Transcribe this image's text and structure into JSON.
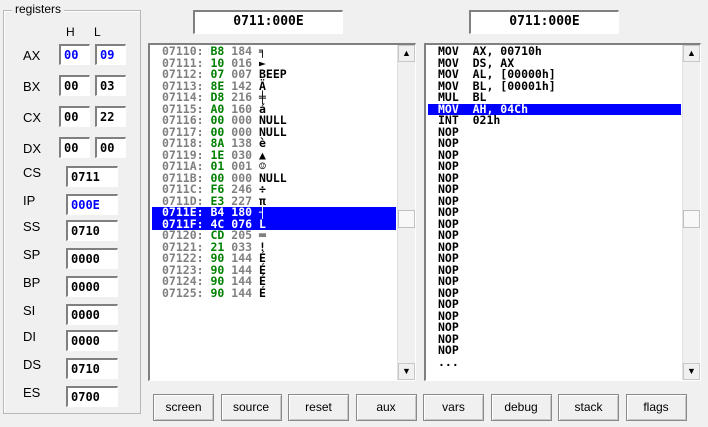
{
  "registers": {
    "title": "registers",
    "col_h": "H",
    "col_l": "L",
    "split": [
      {
        "name": "AX",
        "h": "00",
        "l": "09",
        "h_blue": true,
        "l_blue": true
      },
      {
        "name": "BX",
        "h": "00",
        "l": "03",
        "h_blue": false,
        "l_blue": false
      },
      {
        "name": "CX",
        "h": "00",
        "l": "22",
        "h_blue": false,
        "l_blue": false
      },
      {
        "name": "DX",
        "h": "00",
        "l": "00",
        "h_blue": false,
        "l_blue": false
      }
    ],
    "full": [
      {
        "name": "CS",
        "value": "0711",
        "blue": false
      },
      {
        "name": "IP",
        "value": "000E",
        "blue": true
      },
      {
        "name": "SS",
        "value": "0710",
        "blue": false
      },
      {
        "name": "SP",
        "value": "0000",
        "blue": false
      },
      {
        "name": "BP",
        "value": "0000",
        "blue": false
      },
      {
        "name": "SI",
        "value": "0000",
        "blue": false
      },
      {
        "name": "DI",
        "value": "0000",
        "blue": false
      },
      {
        "name": "DS",
        "value": "0710",
        "blue": false
      },
      {
        "name": "ES",
        "value": "0700",
        "blue": false
      }
    ]
  },
  "memory": {
    "address": "0711:000E",
    "rows": [
      {
        "addr": "07110:",
        "hex": "B8",
        "dec": "184",
        "ch": "╕",
        "sel": false
      },
      {
        "addr": "07111:",
        "hex": "10",
        "dec": "016",
        "ch": "►",
        "sel": false
      },
      {
        "addr": "07112:",
        "hex": "07",
        "dec": "007",
        "ch": "BEEP",
        "sel": false
      },
      {
        "addr": "07113:",
        "hex": "8E",
        "dec": "142",
        "ch": "Ä",
        "sel": false
      },
      {
        "addr": "07114:",
        "hex": "D8",
        "dec": "216",
        "ch": "╪",
        "sel": false
      },
      {
        "addr": "07115:",
        "hex": "A0",
        "dec": "160",
        "ch": "á",
        "sel": false
      },
      {
        "addr": "07116:",
        "hex": "00",
        "dec": "000",
        "ch": "NULL",
        "sel": false
      },
      {
        "addr": "07117:",
        "hex": "00",
        "dec": "000",
        "ch": "NULL",
        "sel": false
      },
      {
        "addr": "07118:",
        "hex": "8A",
        "dec": "138",
        "ch": "è",
        "sel": false
      },
      {
        "addr": "07119:",
        "hex": "1E",
        "dec": "030",
        "ch": "▲",
        "sel": false
      },
      {
        "addr": "0711A:",
        "hex": "01",
        "dec": "001",
        "ch": "☺",
        "sel": false
      },
      {
        "addr": "0711B:",
        "hex": "00",
        "dec": "000",
        "ch": "NULL",
        "sel": false
      },
      {
        "addr": "0711C:",
        "hex": "F6",
        "dec": "246",
        "ch": "÷",
        "sel": false
      },
      {
        "addr": "0711D:",
        "hex": "E3",
        "dec": "227",
        "ch": "π",
        "sel": false
      },
      {
        "addr": "0711E:",
        "hex": "B4",
        "dec": "180",
        "ch": "┤",
        "sel": true
      },
      {
        "addr": "0711F:",
        "hex": "4C",
        "dec": "076",
        "ch": "L",
        "sel": true
      },
      {
        "addr": "07120:",
        "hex": "CD",
        "dec": "205",
        "ch": "═",
        "sel": false
      },
      {
        "addr": "07121:",
        "hex": "21",
        "dec": "033",
        "ch": "!",
        "sel": false
      },
      {
        "addr": "07122:",
        "hex": "90",
        "dec": "144",
        "ch": "É",
        "sel": false
      },
      {
        "addr": "07123:",
        "hex": "90",
        "dec": "144",
        "ch": "É",
        "sel": false
      },
      {
        "addr": "07124:",
        "hex": "90",
        "dec": "144",
        "ch": "É",
        "sel": false
      },
      {
        "addr": "07125:",
        "hex": "90",
        "dec": "144",
        "ch": "É",
        "sel": false
      }
    ]
  },
  "disasm": {
    "address": "0711:000E",
    "rows": [
      {
        "text": "MOV  AX, 00710h",
        "sel": false
      },
      {
        "text": "MOV  DS, AX",
        "sel": false
      },
      {
        "text": "MOV  AL, [00000h]",
        "sel": false
      },
      {
        "text": "MOV  BL, [00001h]",
        "sel": false
      },
      {
        "text": "MUL  BL",
        "sel": false
      },
      {
        "text": "MOV  AH, 04Ch",
        "sel": true
      },
      {
        "text": "INT  021h",
        "sel": false
      },
      {
        "text": "NOP",
        "sel": false
      },
      {
        "text": "NOP",
        "sel": false
      },
      {
        "text": "NOP",
        "sel": false
      },
      {
        "text": "NOP",
        "sel": false
      },
      {
        "text": "NOP",
        "sel": false
      },
      {
        "text": "NOP",
        "sel": false
      },
      {
        "text": "NOP",
        "sel": false
      },
      {
        "text": "NOP",
        "sel": false
      },
      {
        "text": "NOP",
        "sel": false
      },
      {
        "text": "NOP",
        "sel": false
      },
      {
        "text": "NOP",
        "sel": false
      },
      {
        "text": "NOP",
        "sel": false
      },
      {
        "text": "NOP",
        "sel": false
      },
      {
        "text": "NOP",
        "sel": false
      },
      {
        "text": "NOP",
        "sel": false
      },
      {
        "text": "NOP",
        "sel": false
      },
      {
        "text": "NOP",
        "sel": false
      },
      {
        "text": "NOP",
        "sel": false
      },
      {
        "text": "NOP",
        "sel": false
      },
      {
        "text": "NOP",
        "sel": false
      },
      {
        "text": "...",
        "sel": false
      }
    ]
  },
  "buttons": [
    {
      "id": "screen",
      "label": "screen"
    },
    {
      "id": "source",
      "label": "source"
    },
    {
      "id": "reset",
      "label": "reset"
    },
    {
      "id": "aux",
      "label": "aux"
    },
    {
      "id": "vars",
      "label": "vars"
    },
    {
      "id": "debug",
      "label": "debug"
    },
    {
      "id": "stack",
      "label": "stack"
    },
    {
      "id": "flags",
      "label": "flags"
    }
  ],
  "colors": {
    "selection": "#0000ff",
    "register_changed": "#0000ff",
    "hex_code": "#008000",
    "address": "#808080"
  }
}
